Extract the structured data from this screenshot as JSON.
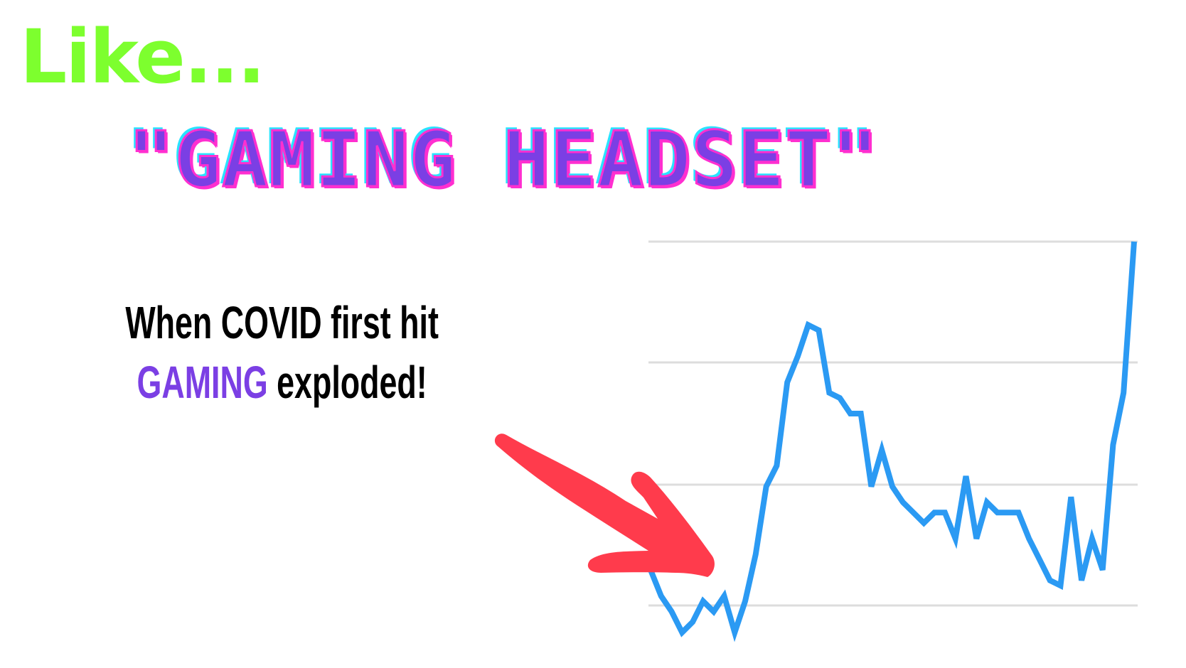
{
  "header": {
    "intro": "Like...",
    "headline": "\"GAMING HEADSET\""
  },
  "caption": {
    "line1": "When COVID first hit",
    "line2_accent": "GAMING",
    "line2_rest": " exploded!"
  },
  "colors": {
    "intro": "#7dff2e",
    "headline": "#7b3fe4",
    "accent": "#7b3fe4",
    "line": "#2b9af3",
    "arrow": "#ff3b4c",
    "grid": "#dddddd"
  },
  "chart_data": {
    "type": "line",
    "title": "",
    "xlabel": "",
    "ylabel": "",
    "grid": true,
    "ylim": [
      0,
      100
    ],
    "gridlines": [
      25,
      50,
      75,
      100
    ],
    "series": [
      {
        "values": [
          12,
          7,
          4,
          0,
          2,
          6,
          4,
          7,
          0,
          6,
          15,
          28,
          32,
          48,
          53,
          59,
          58,
          46,
          45,
          42,
          42,
          28,
          35,
          28,
          25,
          23,
          21,
          23,
          23,
          18,
          30,
          18,
          25,
          23,
          23,
          23,
          18,
          14,
          10,
          9,
          26,
          10,
          18,
          12,
          36,
          46,
          75
        ]
      }
    ],
    "annotation": "arrow pointing to early low point"
  }
}
